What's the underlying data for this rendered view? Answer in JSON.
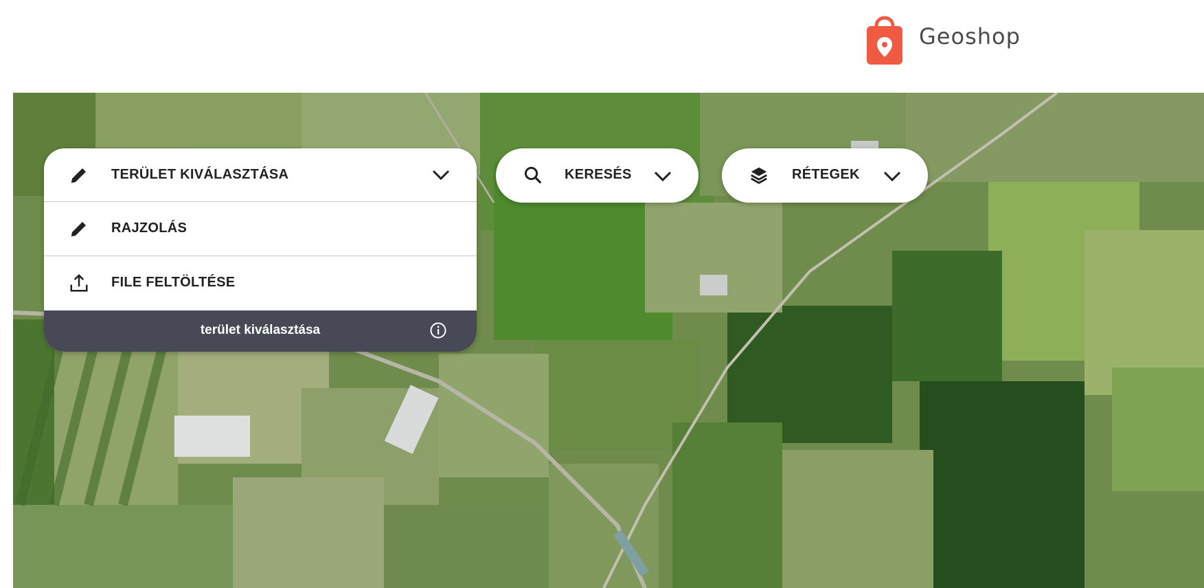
{
  "brand": {
    "name": "Geoshop",
    "accent": "#ef5b42",
    "logo_icon": "shopping-bag-location-icon"
  },
  "area_panel": {
    "title": "TERÜLET KIVÁLASZTÁSA",
    "title_icon": "pencil-icon",
    "items": [
      {
        "label": "RAJZOLÁS",
        "icon": "pencil-icon"
      },
      {
        "label": "FILE FELTÖLTÉSE",
        "icon": "upload-icon"
      }
    ],
    "footer": "terület kiválasztása",
    "footer_icon": "info-icon",
    "footer_bg": "#474a56"
  },
  "search": {
    "label": "KERESÉS",
    "icon": "search-icon"
  },
  "layers": {
    "label": "RÉTEGEK",
    "icon": "layers-icon"
  }
}
